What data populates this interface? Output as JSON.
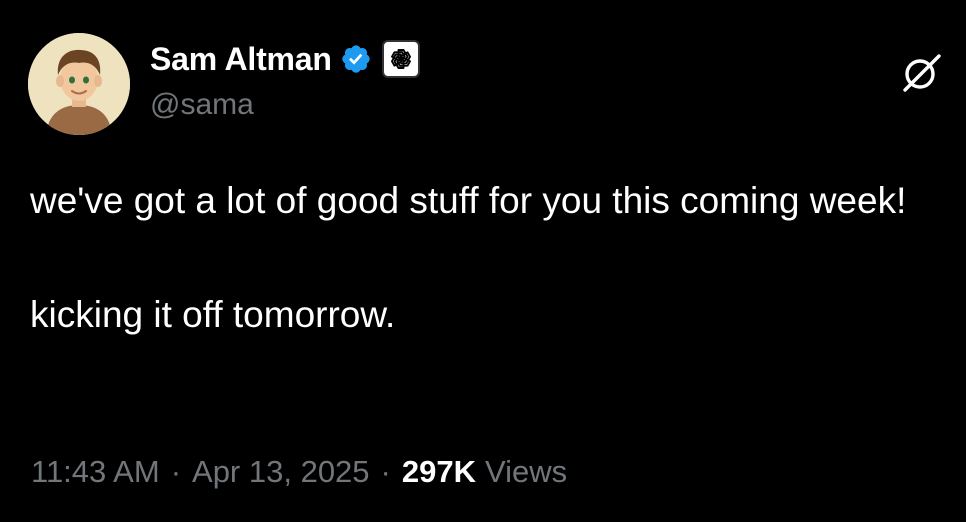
{
  "author": {
    "display_name": "Sam Altman",
    "handle": "@sama",
    "verified": true,
    "verified_icon": "verified-badge-icon",
    "affiliation_icon": "openai-logo-icon",
    "avatar_icon": "avatar-illustration"
  },
  "toolbar": {
    "grok_icon": "grok-icon"
  },
  "tweet": {
    "paragraphs": [
      "we've got a lot of good stuff for you this coming week!",
      "kicking it off tomorrow."
    ]
  },
  "meta": {
    "time": "11:43 AM",
    "separator": "·",
    "date": "Apr 13, 2025",
    "views_count": "297K",
    "views_label": "Views"
  },
  "colors": {
    "background": "#000000",
    "text_primary": "#ffffff",
    "text_secondary": "#71767b",
    "verified_blue": "#1d9bf0"
  }
}
